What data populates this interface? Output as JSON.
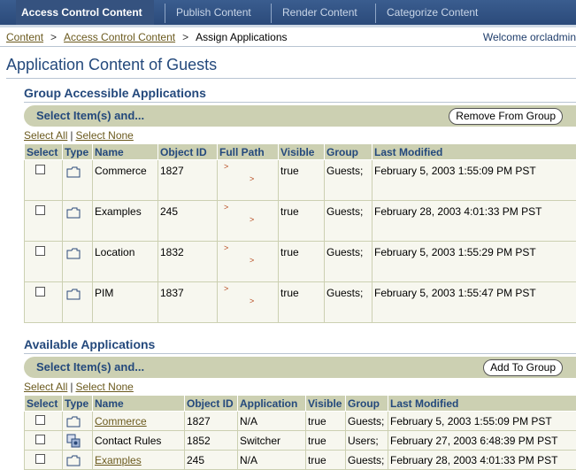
{
  "tabs": [
    {
      "label": "Access Control Content",
      "active": true
    },
    {
      "label": "Publish Content",
      "active": false
    },
    {
      "label": "Render Content",
      "active": false
    },
    {
      "label": "Categorize Content",
      "active": false
    }
  ],
  "breadcrumb": {
    "items": [
      "Content",
      "Access Control Content"
    ],
    "separator": ">",
    "current": "Assign Applications"
  },
  "welcome": "Welcome orcladmin",
  "page_title": "Application Content of Guests",
  "group_section": {
    "title": "Group Accessible Applications",
    "select_label": "Select Item(s) and...",
    "action_button": "Remove From Group",
    "select_all": "Select All",
    "select_none": "Select None",
    "columns": [
      "Select",
      "Type",
      "Name",
      "Object ID",
      "Full Path",
      "Visible",
      "Group",
      "Last Modified"
    ],
    "rows": [
      {
        "name": "Commerce",
        "object_id": "1827",
        "path_marks": [
          ">",
          ">"
        ],
        "visible": "true",
        "group": "Guests;",
        "last_modified": "February 5, 2003 1:55:09 PM PST"
      },
      {
        "name": "Examples",
        "object_id": "245",
        "path_marks": [
          ">",
          ">"
        ],
        "visible": "true",
        "group": "Guests;",
        "last_modified": "February 28, 2003 4:01:33 PM PST"
      },
      {
        "name": "Location",
        "object_id": "1832",
        "path_marks": [
          ">",
          ">"
        ],
        "visible": "true",
        "group": "Guests;",
        "last_modified": "February 5, 2003 1:55:29 PM PST"
      },
      {
        "name": "PIM",
        "object_id": "1837",
        "path_marks": [
          ">",
          ">"
        ],
        "visible": "true",
        "group": "Guests;",
        "last_modified": "February 5, 2003 1:55:47 PM PST"
      }
    ]
  },
  "available_section": {
    "title": "Available Applications",
    "select_label": "Select Item(s) and...",
    "action_button": "Add To Group",
    "select_all": "Select All",
    "select_none": "Select None",
    "columns": [
      "Select",
      "Type",
      "Name",
      "Object ID",
      "Application",
      "Visible",
      "Group",
      "Last Modified"
    ],
    "rows": [
      {
        "name": "Commerce",
        "link": true,
        "icon": "folder-icon",
        "object_id": "1827",
        "application": "N/A",
        "visible": "true",
        "group": "Guests;",
        "last_modified": "February 5, 2003 1:55:09 PM PST"
      },
      {
        "name": "Contact Rules",
        "link": false,
        "icon": "rule-component-icon",
        "object_id": "1852",
        "application": "Switcher",
        "visible": "true",
        "group": "Users;",
        "last_modified": "February 27, 2003 6:48:39 PM PST"
      },
      {
        "name": "Examples",
        "link": true,
        "icon": "folder-icon",
        "object_id": "245",
        "application": "N/A",
        "visible": "true",
        "group": "Guests;",
        "last_modified": "February 28, 2003 4:01:33 PM PST"
      }
    ]
  },
  "colors": {
    "tab_bar": "#2b4a7a",
    "heading": "#24497c",
    "band": "#ccd0b2",
    "link": "#6b5a1e",
    "path_arrow": "#b5471b"
  }
}
